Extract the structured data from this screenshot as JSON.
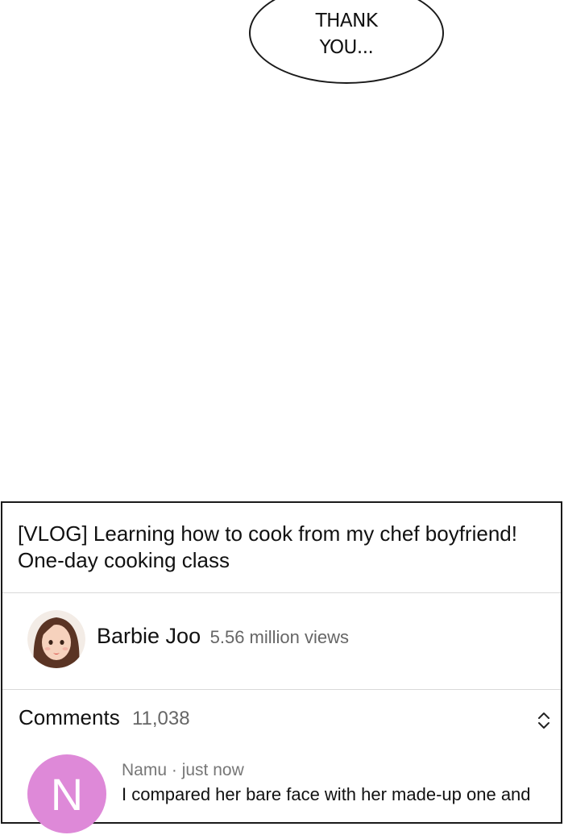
{
  "bubble": {
    "line1": "THANK",
    "line2": "YOU..."
  },
  "video": {
    "title_line1": "[VLOG] Learning how to cook from my chef boyfriend!",
    "title_line2": "One-day cooking class",
    "channel_name": "Barbie Joo",
    "views": "5.56 million views",
    "channel_avatar_icon": "woman-portrait-avatar"
  },
  "comments": {
    "label": "Comments",
    "count": "11,038",
    "expand_icon": "chevron-up-down-icon",
    "items": [
      {
        "avatar_letter": "N",
        "avatar_color": "#de89d8",
        "author": "Namu",
        "time": "just now",
        "text": "I compared her bare face with her made-up one and"
      }
    ]
  }
}
